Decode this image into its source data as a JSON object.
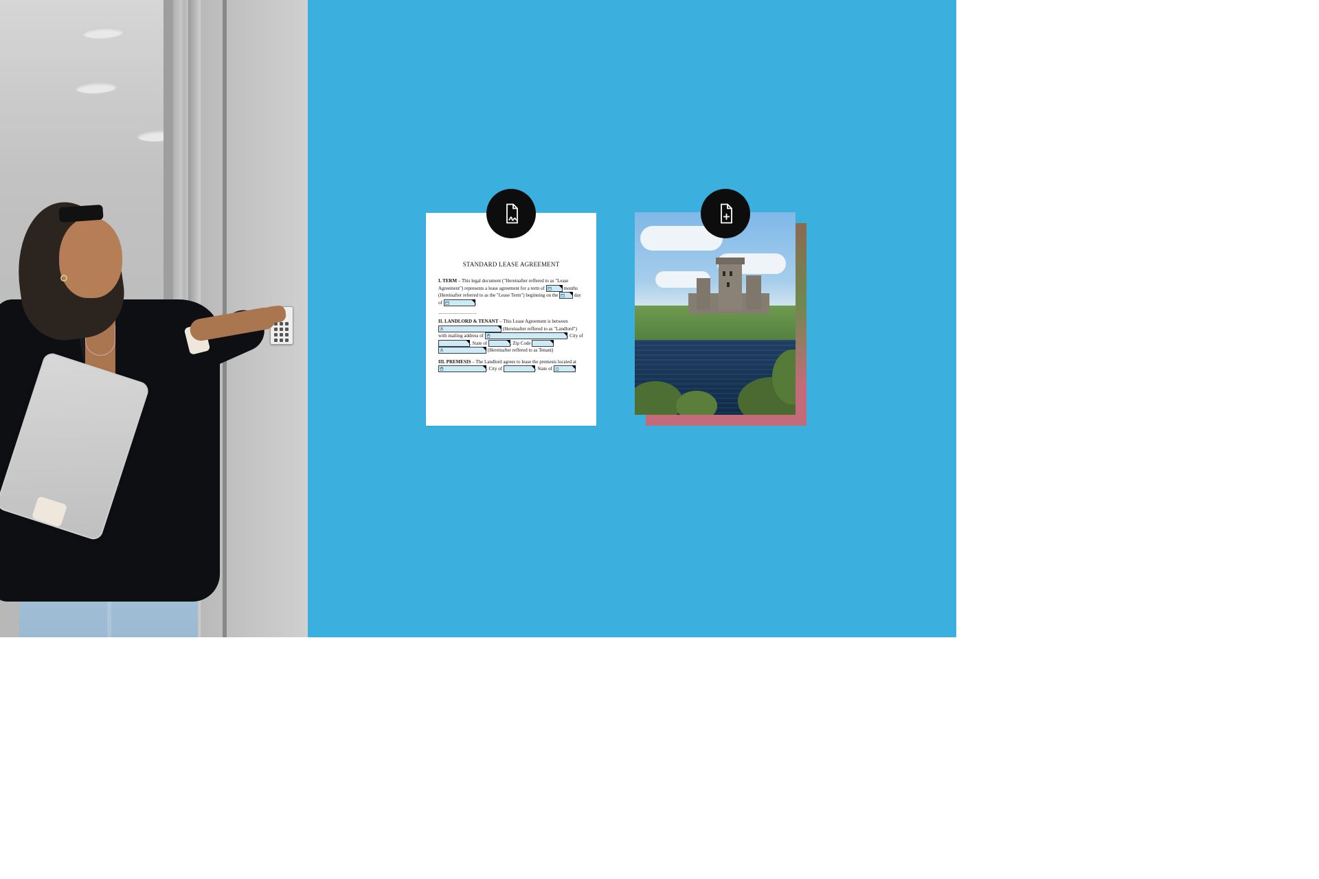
{
  "left_image": {
    "description": "Woman in black blazer holding a silver laptop, pressing a wall keypad beside a glass building entrance"
  },
  "badges": {
    "sign": "document-sign-icon",
    "add": "document-add-icon"
  },
  "document": {
    "title": "STANDARD LEASE AGREEMENT",
    "section1": {
      "label": "I. TERM",
      "t1": " – This legal document (\"Hereinafter reffered to as \"Lease Agreement\") represents a lease agreement for a term of ",
      "t2": " months (Hereinafter referred to as the \"Lease Term\") beginning on the ",
      "t3": " day of ",
      "t4": ", "
    },
    "section2": {
      "label": "II. LANDLORD & TENANT",
      "t1": " – This Lease Agreement is between ",
      "t2": " (Hereinafter reffered to as \"Landlord\") with mailing address of ",
      "t3": ", City of ",
      "t4": ", State of ",
      "t5": ", Zip Code ",
      "t6": " (Hereinafter reffered to as Tenant)"
    },
    "section3": {
      "label": "III. PREMESIS",
      "t1": " – The Landlord agrees to lease the premesis located at ",
      "t2": ", City of ",
      "t3": ", State of "
    }
  },
  "photo_card": {
    "description": "Stone castle on grassy shore by a lake under blue sky, stacked over a second photo of flowers and greenery"
  }
}
